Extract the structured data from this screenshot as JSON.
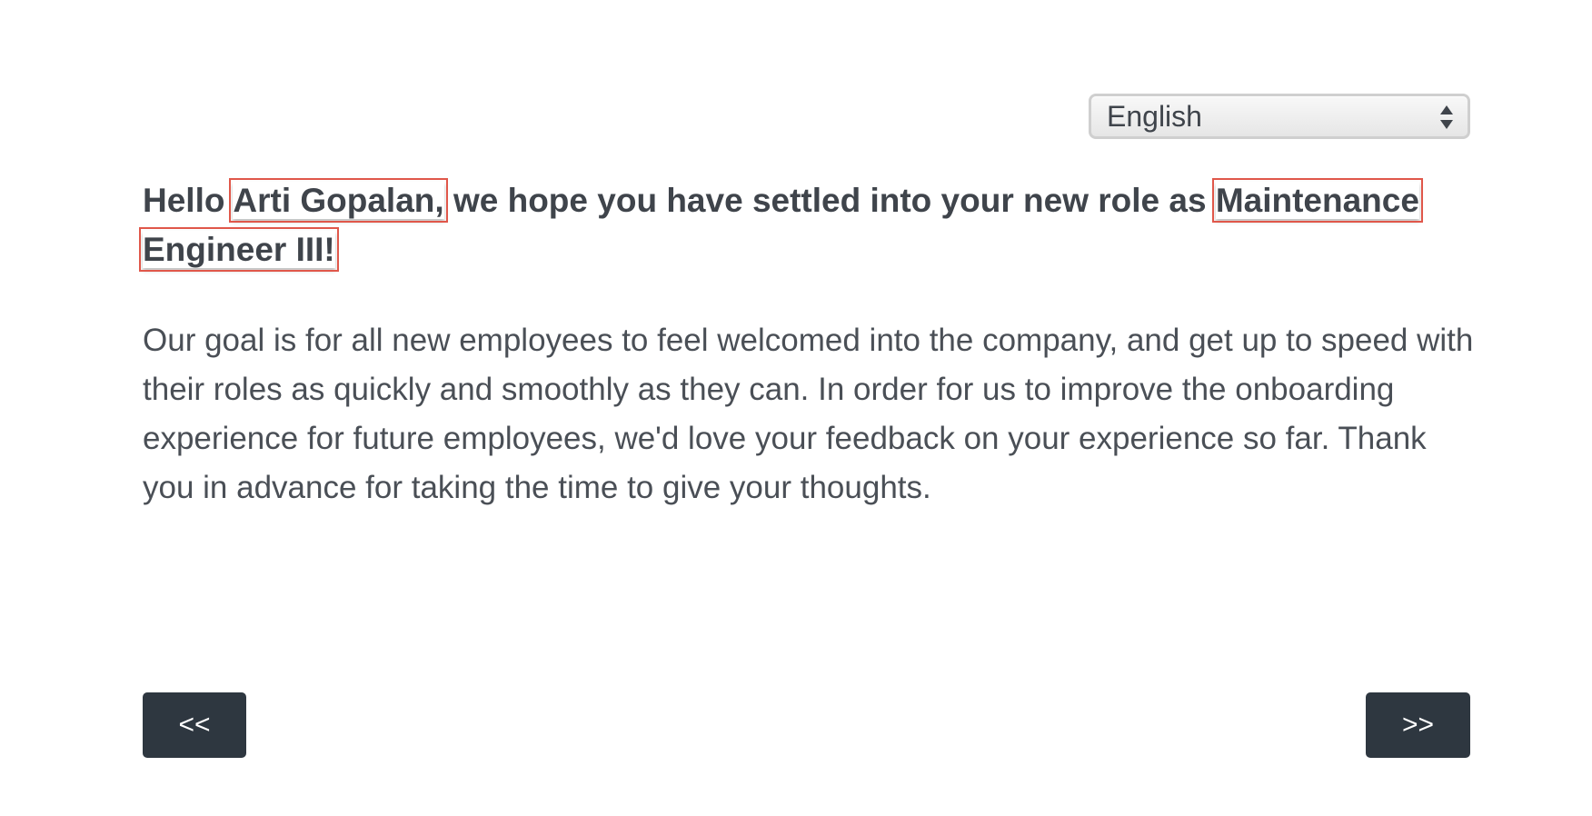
{
  "language_select": {
    "selected": "English"
  },
  "greeting": {
    "prefix": "Hello ",
    "name": "Arti Gopalan,",
    "middle": " we hope you have settled into your new role as ",
    "role_line1": "Maintenance",
    "role_line2": "Engineer III!"
  },
  "body": {
    "paragraph": "Our goal is for all new employees to feel welcomed into the company, and get up to speed with their roles as quickly and smoothly as they can.  In order for us to improve the onboarding experience for future employees, we'd love your feedback on your experience so far. Thank you in advance for taking the time to give your thoughts."
  },
  "navigation": {
    "prev_label": "<<",
    "next_label": ">>"
  },
  "colors": {
    "text": "#3f444b",
    "button_bg": "#2e3740",
    "highlight_border": "#e0574a"
  }
}
